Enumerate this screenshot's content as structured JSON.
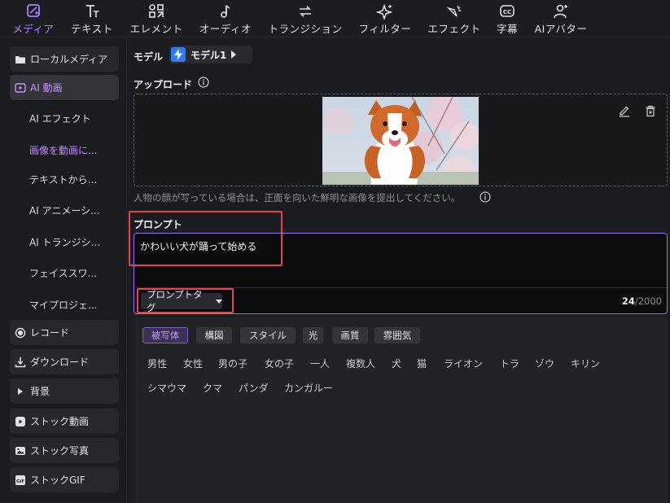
{
  "toolbar": {
    "items": [
      {
        "label": "メディア",
        "icon": "media-icon"
      },
      {
        "label": "テキスト",
        "icon": "text-icon"
      },
      {
        "label": "エレメント",
        "icon": "element-icon"
      },
      {
        "label": "オーディオ",
        "icon": "audio-icon"
      },
      {
        "label": "トランジション",
        "icon": "transition-icon"
      },
      {
        "label": "フィルター",
        "icon": "filter-icon"
      },
      {
        "label": "エフェクト",
        "icon": "effect-icon"
      },
      {
        "label": "字幕",
        "icon": "subtitle-icon"
      },
      {
        "label": "AIアバター",
        "icon": "avatar-icon"
      }
    ],
    "accent_color": "#b07cff"
  },
  "sidebar": {
    "items": [
      {
        "label": "ローカルメディア",
        "icon": "folder-icon"
      },
      {
        "label": "AI 動画",
        "icon": "ai-video-icon"
      },
      {
        "label": "レコード",
        "icon": "record-icon"
      },
      {
        "label": "ダウンロード",
        "icon": "download-icon"
      },
      {
        "label": "背景",
        "icon": "triangle-right-icon"
      },
      {
        "label": "ストック動画",
        "icon": "play-icon"
      },
      {
        "label": "ストック写真",
        "icon": "photo-icon"
      },
      {
        "label": "ストックGIF",
        "icon": "gif-icon"
      }
    ],
    "sub_items": [
      {
        "label": "AI エフェクト"
      },
      {
        "label": "画像を動画に..."
      },
      {
        "label": "テキストから..."
      },
      {
        "label": "AI アニメーシ..."
      },
      {
        "label": "AI トランジシ..."
      },
      {
        "label": "フェイススワ..."
      },
      {
        "label": "マイプロジェ..."
      }
    ]
  },
  "main": {
    "model_label": "モデル",
    "model_name": "モデル1",
    "upload_label": "アップロード",
    "upload_note": "人物の顔が写っている場合は、正面を向いた鮮明な画像を提出してください。",
    "prompt_label": "プロンプト",
    "prompt_value": "かわいい犬が踊って始める",
    "prompt_tag_button": "プロンプトタグ",
    "char_count": "24",
    "char_limit": "/2000",
    "categories": [
      "被写体",
      "構図",
      "スタイル",
      "光",
      "画質",
      "雰囲気"
    ],
    "tags_row1": [
      "男性",
      "女性",
      "男の子",
      "女の子",
      "一人",
      "複数人",
      "犬",
      "猫",
      "ライオン",
      "トラ",
      "ゾウ",
      "キリン"
    ],
    "tags_row2": [
      "シマウマ",
      "クマ",
      "パンダ",
      "カンガルー"
    ],
    "highlight_color": "#e8424a",
    "prompt_border_color": "#9b6bff"
  }
}
